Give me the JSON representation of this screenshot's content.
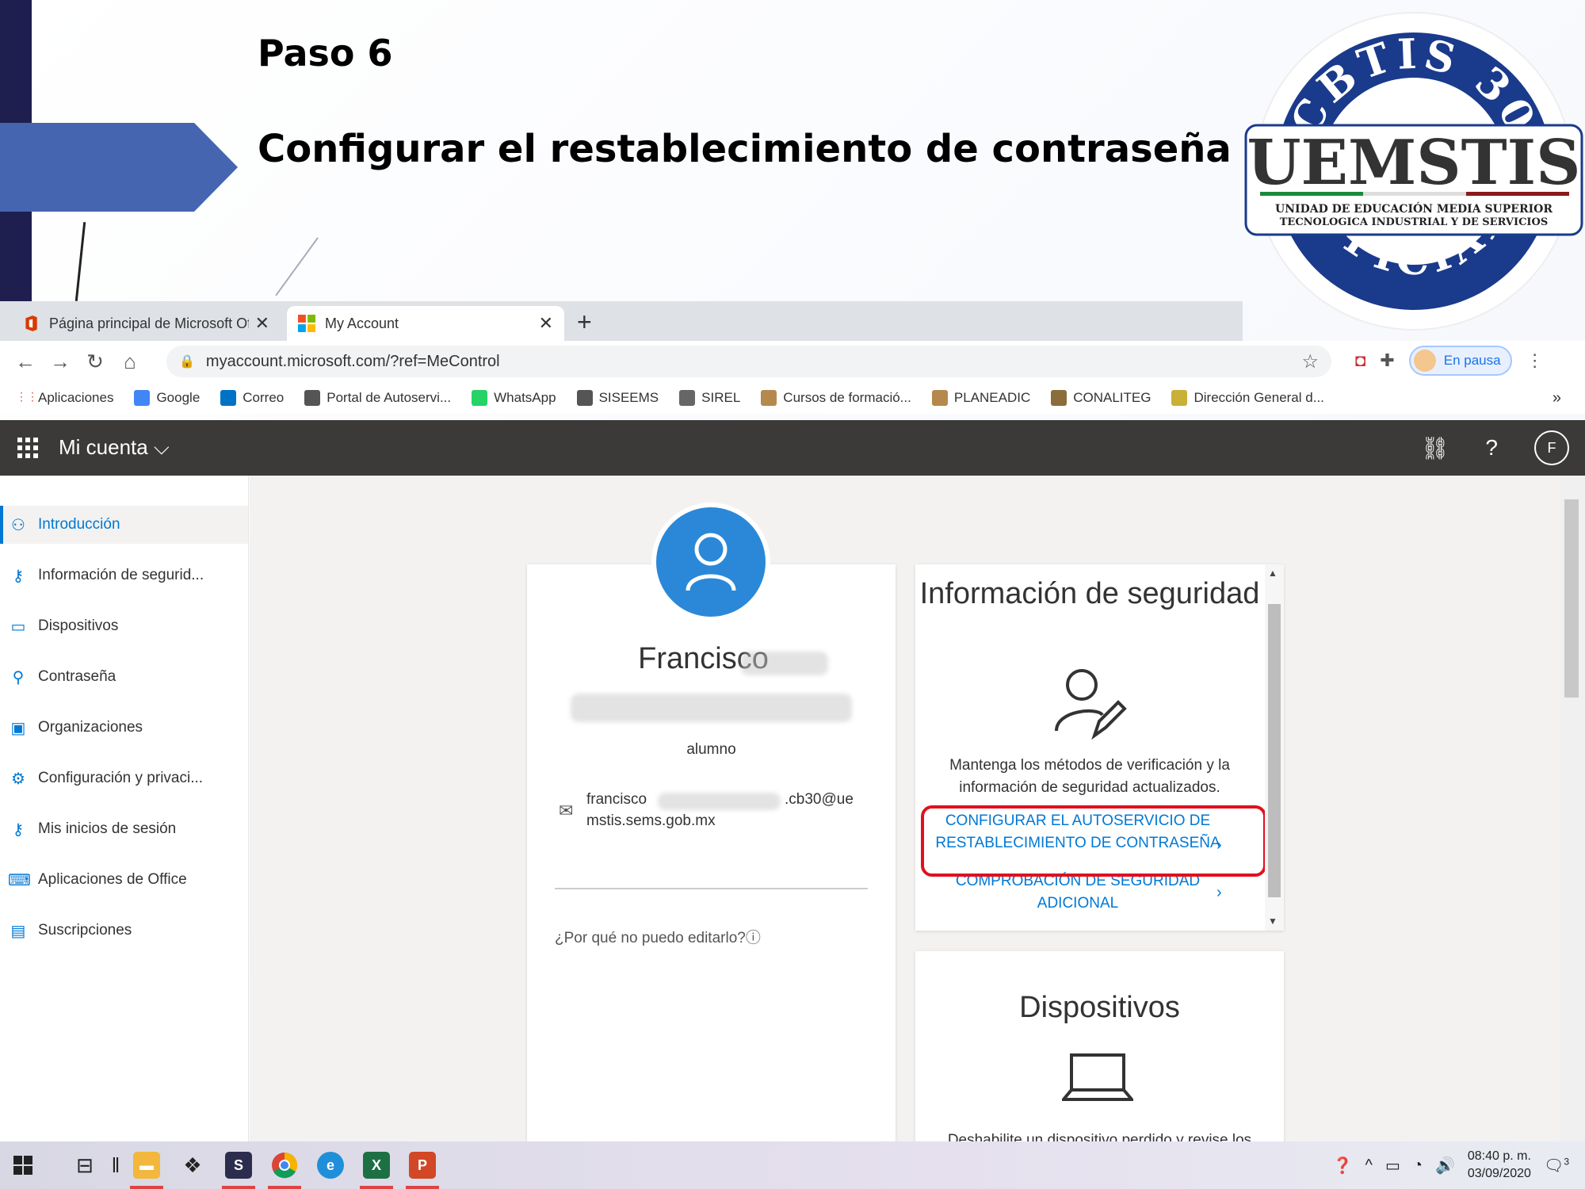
{
  "slide": {
    "step": "Paso 6",
    "subtitle": "Configurar el restablecimiento de contraseña"
  },
  "logo": {
    "top_arc": "CBTIS 30",
    "main": "UEMSTIS",
    "line1": "UNIDAD DE EDUCACIÓN MEDIA SUPERIOR",
    "line2": "TECNOLOGICA INDUSTRIAL Y DE SERVICIOS",
    "bottom_arc": "OFICIAL"
  },
  "browser": {
    "tabs": [
      {
        "title": "Página principal de Microsoft Of",
        "icon": "office-icon"
      },
      {
        "title": "My Account",
        "icon": "microsoft-icon"
      }
    ],
    "new_tab": "+",
    "url": "myaccount.microsoft.com/?ref=MeControl",
    "profile_status": "En pausa",
    "bookmarks": [
      {
        "label": "Aplicaciones",
        "color": "#ea4335"
      },
      {
        "label": "Google",
        "color": "#4285f4"
      },
      {
        "label": "Correo",
        "color": "#0072c6"
      },
      {
        "label": "Portal de Autoservi...",
        "color": "#555555"
      },
      {
        "label": "WhatsApp",
        "color": "#25d366"
      },
      {
        "label": "SISEEMS",
        "color": "#555555"
      },
      {
        "label": "SIREL",
        "color": "#666666"
      },
      {
        "label": "Cursos de formació...",
        "color": "#b5894d"
      },
      {
        "label": "PLANEADIC",
        "color": "#b5894d"
      },
      {
        "label": "CONALITEG",
        "color": "#8a6d3b"
      },
      {
        "label": "Dirección General d...",
        "color": "#c9b037"
      }
    ],
    "bookmarks_more": "»"
  },
  "app": {
    "title": "Mi cuenta",
    "avatar_initial": "F",
    "help": "?",
    "sidebar": [
      {
        "label": "Introducción",
        "icon": "person-icon",
        "active": true
      },
      {
        "label": "Información de segurid...",
        "icon": "person-key-icon"
      },
      {
        "label": "Dispositivos",
        "icon": "laptop-icon"
      },
      {
        "label": "Contraseña",
        "icon": "key-icon"
      },
      {
        "label": "Organizaciones",
        "icon": "briefcase-icon"
      },
      {
        "label": "Configuración y privaci...",
        "icon": "gear-icon"
      },
      {
        "label": "Mis inicios de sesión",
        "icon": "person-key-icon"
      },
      {
        "label": "Aplicaciones de Office",
        "icon": "keyboard-icon"
      },
      {
        "label": "Suscripciones",
        "icon": "card-icon"
      }
    ],
    "profile": {
      "name": "Francisco",
      "role": "alumno",
      "email_start": "francisco",
      "email_mid": ".cb30@ue",
      "email_end": "mstis.sems.gob.mx",
      "why_cant_edit": "¿Por qué no puedo editarlo?"
    },
    "security": {
      "title": "Información de seguridad",
      "description": "Mantenga los métodos de verificación y la información de seguridad actualizados.",
      "link_sspr": "CONFIGURAR EL AUTOSERVICIO DE RESTABLECIMIENTO DE CONTRASEÑA",
      "link_mfa": "COMPROBACIÓN DE SEGURIDAD ADICIONAL"
    },
    "devices": {
      "title": "Dispositivos",
      "description": "Deshabilite un dispositivo perdido y revise los"
    }
  },
  "taskbar": {
    "time": "08:40 p. m.",
    "date": "03/09/2020",
    "notifications": "3",
    "highlight_color": "#e0101e"
  }
}
